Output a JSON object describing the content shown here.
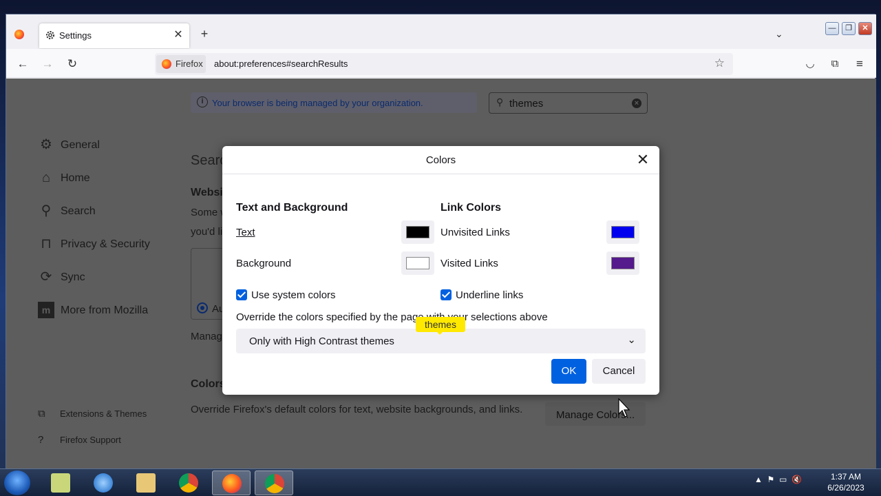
{
  "browser": {
    "tab_title": "Settings",
    "close_tab": "✕",
    "new_tab": "+",
    "identity_label": "Firefox",
    "url": "about:preferences#searchResults"
  },
  "notice": {
    "text": "Your browser is being managed by your organization."
  },
  "search": {
    "value": "themes"
  },
  "sidebar": {
    "items": [
      {
        "label": "General",
        "icon": "gear-icon"
      },
      {
        "label": "Home",
        "icon": "home-icon"
      },
      {
        "label": "Search",
        "icon": "search-icon"
      },
      {
        "label": "Privacy & Security",
        "icon": "lock-icon"
      },
      {
        "label": "Sync",
        "icon": "sync-icon"
      },
      {
        "label": "More from Mozilla",
        "icon": "mozilla-icon"
      }
    ],
    "footer": [
      {
        "label": "Extensions & Themes",
        "icon": "puzzle-icon"
      },
      {
        "label": "Firefox Support",
        "icon": "help-icon"
      }
    ]
  },
  "background_page": {
    "heading": "Search Results",
    "websites_heading": "Websi",
    "line1": "Some w",
    "line2": "you'd li",
    "radio_label": "Au",
    "manage_label": "Manag",
    "colors_heading": "Colors",
    "colors_desc": "Override Firefox's default colors for text, website backgrounds, and links.",
    "manage_colors_button": "Manage Colors..."
  },
  "dialog": {
    "title": "Colors",
    "text_bg_heading": "Text and Background",
    "link_heading": "Link Colors",
    "text_label": "Text",
    "background_label": "Background",
    "unvisited_label": "Unvisited Links",
    "visited_label": "Visited Links",
    "use_system_label": "Use system colors",
    "underline_label": "Underline links",
    "override_label": "Override the colors specified by the page with your selections above",
    "select_value": "Only with High Contrast themes",
    "ok": "OK",
    "cancel": "Cancel",
    "colors": {
      "text": "#000000",
      "background": "#ffffff",
      "unvisited": "#0000ee",
      "visited": "#551a8b"
    }
  },
  "tooltip": "themes",
  "clock": {
    "time": "1:37 AM",
    "date": "6/26/2023"
  }
}
